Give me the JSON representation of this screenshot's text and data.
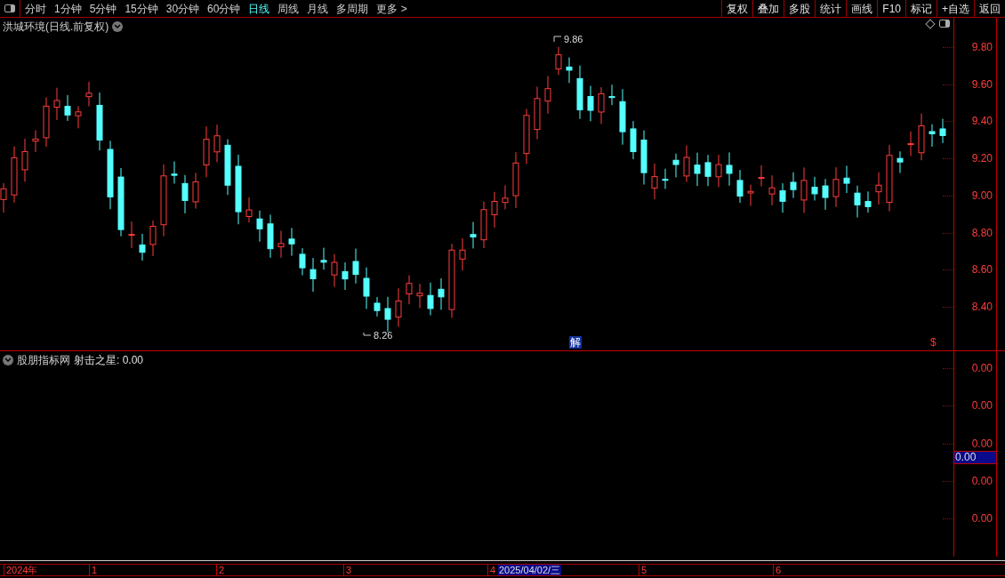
{
  "toolbar": {
    "periods": [
      {
        "label": "分时",
        "selected": false
      },
      {
        "label": "1分钟",
        "selected": false
      },
      {
        "label": "5分钟",
        "selected": false
      },
      {
        "label": "15分钟",
        "selected": false
      },
      {
        "label": "30分钟",
        "selected": false
      },
      {
        "label": "60分钟",
        "selected": false
      },
      {
        "label": "日线",
        "selected": true
      },
      {
        "label": "周线",
        "selected": false
      },
      {
        "label": "月线",
        "selected": false
      },
      {
        "label": "多周期",
        "selected": false
      },
      {
        "label": "更多 >",
        "selected": false
      }
    ],
    "actions": [
      "复权",
      "叠加",
      "多股",
      "统计",
      "画线",
      "F10",
      "标记",
      "+自选",
      "返回"
    ]
  },
  "price_chart": {
    "title": "洪城环境(日线.前复权)",
    "price_ticks": [
      "9.80",
      "9.60",
      "9.40",
      "9.20",
      "9.00",
      "8.80",
      "8.60",
      "8.40"
    ],
    "high_label": "9.86",
    "low_label": "8.26",
    "signal_marks": [
      {
        "label": "解",
        "kind": "box"
      },
      {
        "label": "$",
        "kind": "text"
      }
    ]
  },
  "indicator": {
    "source": "股朋指标网",
    "name": "射击之星",
    "value": ": 0.00",
    "ticks": [
      "0.00",
      "0.00",
      "0.00",
      "0.00",
      "0.00"
    ],
    "cursor_value": "0.00"
  },
  "time_axis": {
    "labels": [
      "2024年",
      "1",
      "2",
      "3",
      "4",
      "5",
      "6"
    ],
    "cursor_date": "2025/04/02/三"
  }
}
